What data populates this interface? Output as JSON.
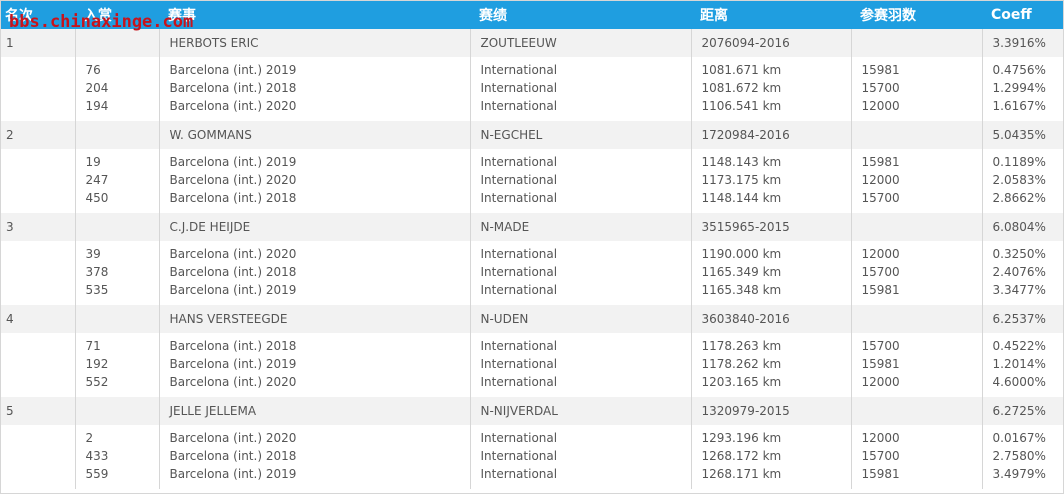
{
  "headers": {
    "rank": "名次",
    "prize": "入赏",
    "race": "赛事",
    "result": "赛绩",
    "distance": "距离",
    "birds": "参赛羽数",
    "coeff": "Coeff"
  },
  "watermark": "bbs.chinaxinge.com",
  "rows": [
    {
      "rank": "1",
      "name": "HERBOTS ERIC",
      "location": "ZOUTLEEUW",
      "ring": "2076094-2016",
      "coeff": "3.3916%",
      "details": [
        {
          "prize": "76",
          "race": "Barcelona (int.) 2019",
          "result": "International",
          "distance": "1081.671 km",
          "birds": "15981",
          "coeff": "0.4756%"
        },
        {
          "prize": "204",
          "race": "Barcelona (int.) 2018",
          "result": "International",
          "distance": "1081.672 km",
          "birds": "15700",
          "coeff": "1.2994%"
        },
        {
          "prize": "194",
          "race": "Barcelona (int.) 2020",
          "result": "International",
          "distance": "1106.541 km",
          "birds": "12000",
          "coeff": "1.6167%"
        }
      ]
    },
    {
      "rank": "2",
      "name": "W. GOMMANS",
      "location": "N-EGCHEL",
      "ring": "1720984-2016",
      "coeff": "5.0435%",
      "details": [
        {
          "prize": "19",
          "race": "Barcelona (int.) 2019",
          "result": "International",
          "distance": "1148.143 km",
          "birds": "15981",
          "coeff": "0.1189%"
        },
        {
          "prize": "247",
          "race": "Barcelona (int.) 2020",
          "result": "International",
          "distance": "1173.175 km",
          "birds": "12000",
          "coeff": "2.0583%"
        },
        {
          "prize": "450",
          "race": "Barcelona (int.) 2018",
          "result": "International",
          "distance": "1148.144 km",
          "birds": "15700",
          "coeff": "2.8662%"
        }
      ]
    },
    {
      "rank": "3",
      "name": "C.J.DE HEIJDE",
      "location": "N-MADE",
      "ring": "3515965-2015",
      "coeff": "6.0804%",
      "details": [
        {
          "prize": "39",
          "race": "Barcelona (int.) 2020",
          "result": "International",
          "distance": "1190.000 km",
          "birds": "12000",
          "coeff": "0.3250%"
        },
        {
          "prize": "378",
          "race": "Barcelona (int.) 2018",
          "result": "International",
          "distance": "1165.349 km",
          "birds": "15700",
          "coeff": "2.4076%"
        },
        {
          "prize": "535",
          "race": "Barcelona (int.) 2019",
          "result": "International",
          "distance": "1165.348 km",
          "birds": "15981",
          "coeff": "3.3477%"
        }
      ]
    },
    {
      "rank": "4",
      "name": "HANS VERSTEEGDE",
      "location": "N-UDEN",
      "ring": "3603840-2016",
      "coeff": "6.2537%",
      "details": [
        {
          "prize": "71",
          "race": "Barcelona (int.) 2018",
          "result": "International",
          "distance": "1178.263 km",
          "birds": "15700",
          "coeff": "0.4522%"
        },
        {
          "prize": "192",
          "race": "Barcelona (int.) 2019",
          "result": "International",
          "distance": "1178.262 km",
          "birds": "15981",
          "coeff": "1.2014%"
        },
        {
          "prize": "552",
          "race": "Barcelona (int.) 2020",
          "result": "International",
          "distance": "1203.165 km",
          "birds": "12000",
          "coeff": "4.6000%"
        }
      ]
    },
    {
      "rank": "5",
      "name": "JELLE JELLEMA",
      "location": "N-NIJVERDAL",
      "ring": "1320979-2015",
      "coeff": "6.2725%",
      "details": [
        {
          "prize": "2",
          "race": "Barcelona (int.) 2020",
          "result": "International",
          "distance": "1293.196 km",
          "birds": "12000",
          "coeff": "0.0167%"
        },
        {
          "prize": "433",
          "race": "Barcelona (int.) 2018",
          "result": "International",
          "distance": "1268.172 km",
          "birds": "15700",
          "coeff": "2.7580%"
        },
        {
          "prize": "559",
          "race": "Barcelona (int.) 2019",
          "result": "International",
          "distance": "1268.171 km",
          "birds": "15981",
          "coeff": "3.4979%"
        }
      ]
    }
  ]
}
